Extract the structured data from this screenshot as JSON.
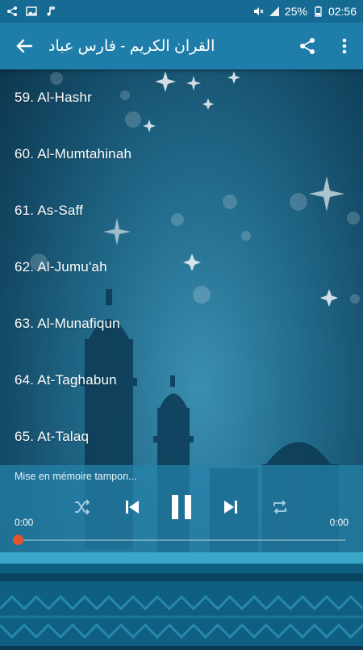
{
  "status_bar": {
    "battery": "25%",
    "time": "02:56",
    "left_icons": [
      "share-icon",
      "image-icon",
      "music-note-icon"
    ],
    "right_icons": [
      "mute-icon",
      "signal-icon",
      "battery-icon"
    ]
  },
  "app_bar": {
    "title": "القران الكريم - فارس عباد",
    "back_icon": "arrow-back-icon",
    "share_icon": "share-icon",
    "menu_icon": "more-vert-icon"
  },
  "surahs": [
    "59. Al-Hashr",
    "60. Al-Mumtahinah",
    "61. As-Saff",
    "62. Al-Jumu'ah",
    "63. Al-Munafiqun",
    "64. At-Taghabun",
    "65. At-Talaq"
  ],
  "player": {
    "status": "Mise en mémoire tampon...",
    "current_time": "0:00",
    "total_time": "0:00",
    "progress": 0,
    "accent": "#e5532b",
    "controls": [
      "shuffle-icon",
      "skip-previous-icon",
      "pause-icon",
      "skip-next-icon",
      "repeat-icon"
    ]
  }
}
